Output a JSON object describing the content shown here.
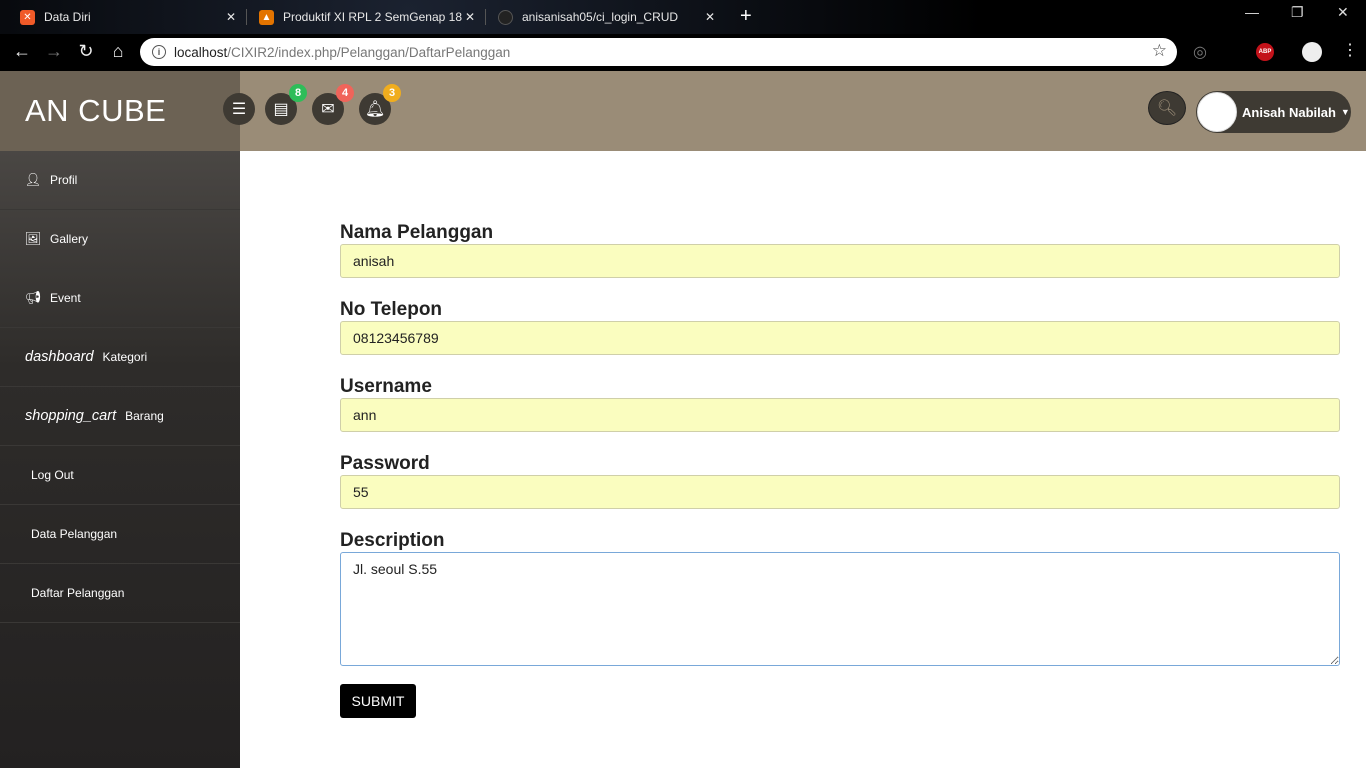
{
  "browser": {
    "tabs": [
      {
        "title": "Data Diri",
        "icon": "xampp-icon",
        "color": "#f05a28"
      },
      {
        "title": "Produktif XI RPL 2 SemGenap 18",
        "icon": "classroom-icon",
        "color": "#e37400"
      },
      {
        "title": "anisanisah05/ci_login_CRUD",
        "icon": "github-icon",
        "color": "#222222"
      }
    ],
    "url_host": "localhost",
    "url_path": "/CIXIR2/index.php/Pelanggan/DaftarPelanggan",
    "extension_abp": "ABP"
  },
  "header": {
    "brand": "AN CUBE",
    "badges": {
      "tasks": "8",
      "messages": "4",
      "notifications": "3"
    },
    "badge_colors": {
      "tasks": "#2ebd59",
      "messages": "#f0645a",
      "notifications": "#f0ad1e"
    },
    "user_name": "Anisah Nabilah"
  },
  "sidebar": {
    "items": [
      {
        "icon": "user-icon",
        "label": "Profil"
      },
      {
        "icon": "image-icon",
        "label": "Gallery"
      },
      {
        "icon": "bullhorn-icon",
        "label": "Event"
      },
      {
        "ligature": "dashboard",
        "label": "Kategori"
      },
      {
        "ligature": "shopping_cart",
        "label": "Barang"
      },
      {
        "label": "Log Out"
      },
      {
        "label": "Data Pelanggan"
      },
      {
        "label": "Daftar Pelanggan"
      }
    ]
  },
  "form": {
    "nama_label": "Nama Pelanggan",
    "nama_value": "anisah",
    "telepon_label": "No Telepon",
    "telepon_value": "08123456789",
    "username_label": "Username",
    "username_value": "ann",
    "password_label": "Password",
    "password_value": "55",
    "description_label": "Description",
    "description_value": "Jl. seoul S.55",
    "submit_label": "SUBMIT"
  }
}
